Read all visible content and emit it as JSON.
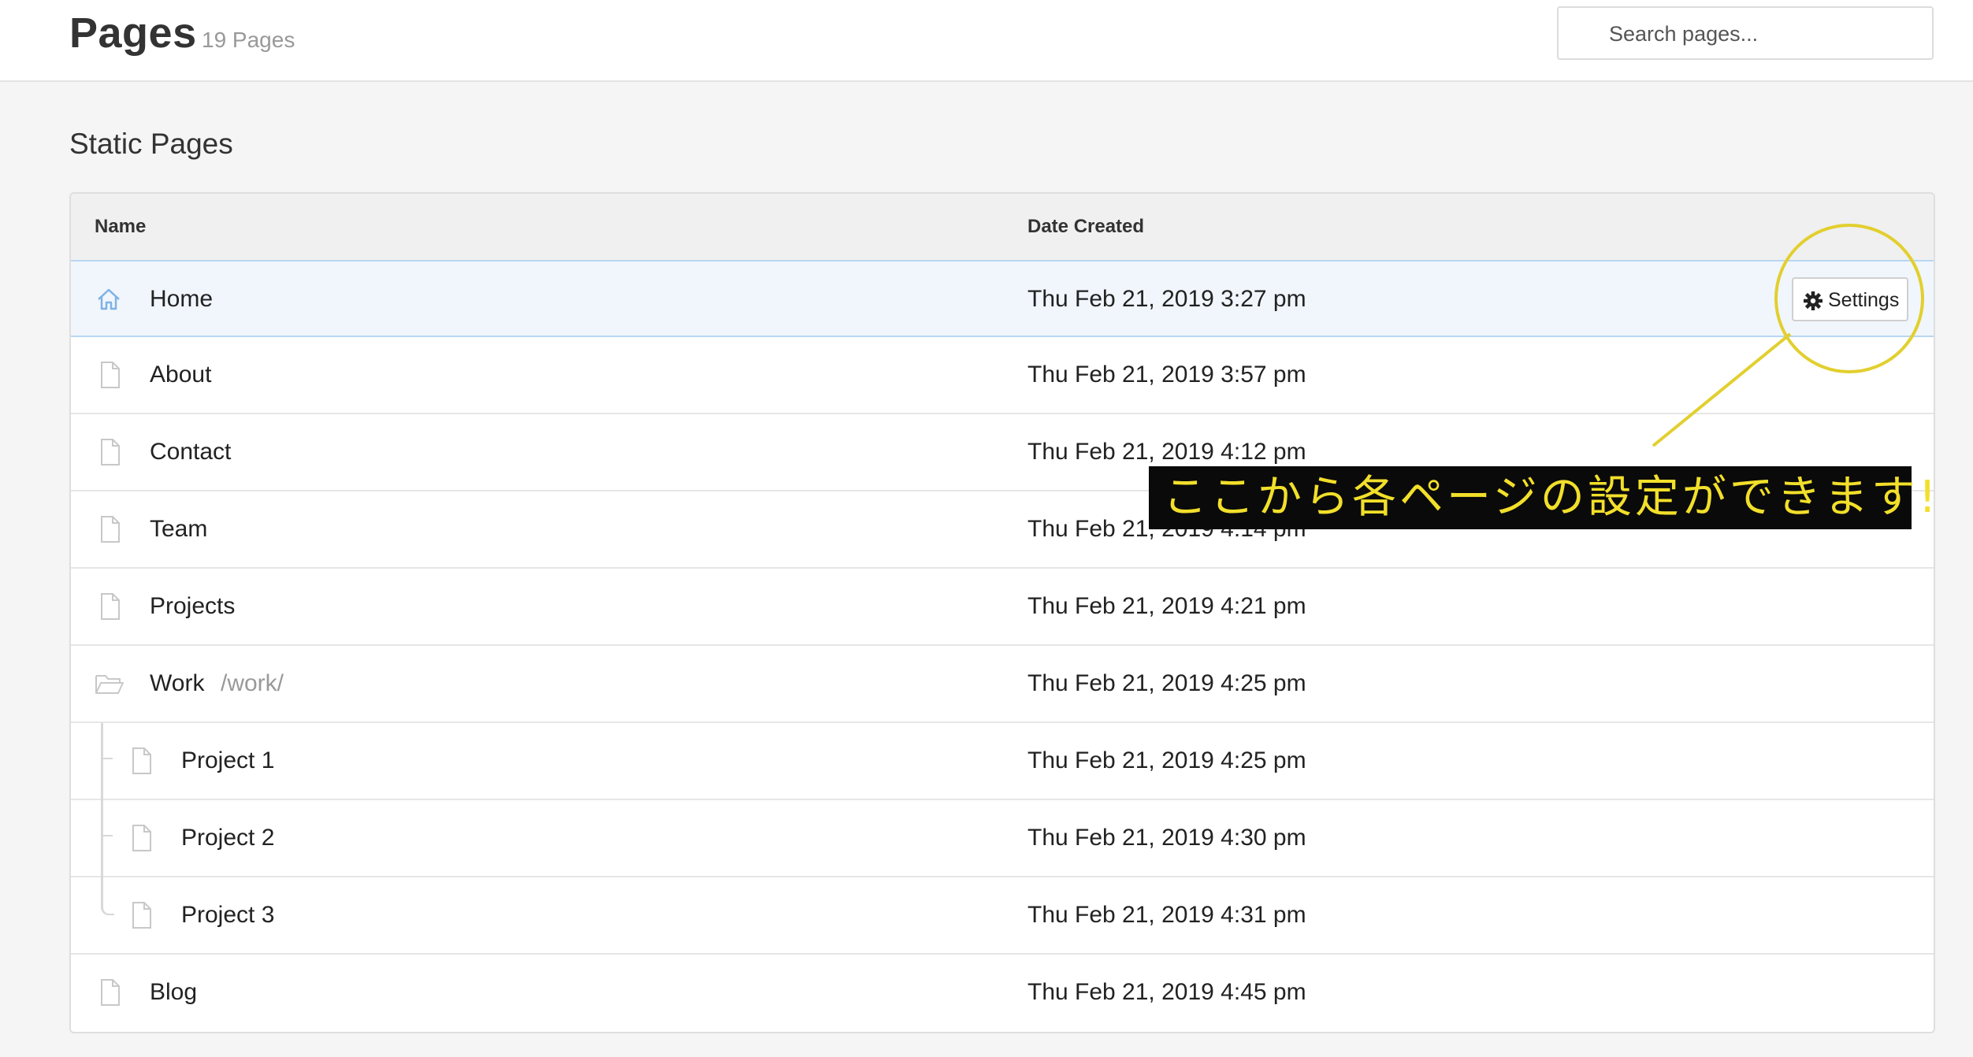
{
  "header": {
    "title": "Pages",
    "count_label": "19 Pages",
    "search_placeholder": "Search pages..."
  },
  "section": {
    "title": "Static Pages"
  },
  "table": {
    "columns": {
      "name": "Name",
      "date_created": "Date Created"
    },
    "rows": [
      {
        "name": "Home",
        "icon": "home-icon",
        "date": "Thu Feb 21, 2019 3:27 pm",
        "highlighted": true
      },
      {
        "name": "About",
        "icon": "page-icon",
        "date": "Thu Feb 21, 2019 3:57 pm"
      },
      {
        "name": "Contact",
        "icon": "page-icon",
        "date": "Thu Feb 21, 2019 4:12 pm"
      },
      {
        "name": "Team",
        "icon": "page-icon",
        "date": "Thu Feb 21, 2019 4:14 pm"
      },
      {
        "name": "Projects",
        "icon": "page-icon",
        "date": "Thu Feb 21, 2019 4:21 pm"
      },
      {
        "name": "Work",
        "route": "/work/",
        "icon": "folder-icon",
        "date": "Thu Feb 21, 2019 4:25 pm"
      },
      {
        "name": "Project 1",
        "icon": "page-icon",
        "date": "Thu Feb 21, 2019 4:25 pm",
        "child": true
      },
      {
        "name": "Project 2",
        "icon": "page-icon",
        "date": "Thu Feb 21, 2019 4:30 pm",
        "child": true
      },
      {
        "name": "Project 3",
        "icon": "page-icon",
        "date": "Thu Feb 21, 2019 4:31 pm",
        "child": true
      },
      {
        "name": "Blog",
        "icon": "page-icon",
        "date": "Thu Feb 21, 2019 4:45 pm"
      }
    ],
    "settings_button": "Settings"
  },
  "annotation": {
    "text": "ここから各ページの設定ができます!",
    "color": "#e2cf2e"
  },
  "colors": {
    "highlight_row": "#f0f6fc",
    "highlight_border": "#b9d6f2",
    "home_icon": "#7fb2e5"
  }
}
